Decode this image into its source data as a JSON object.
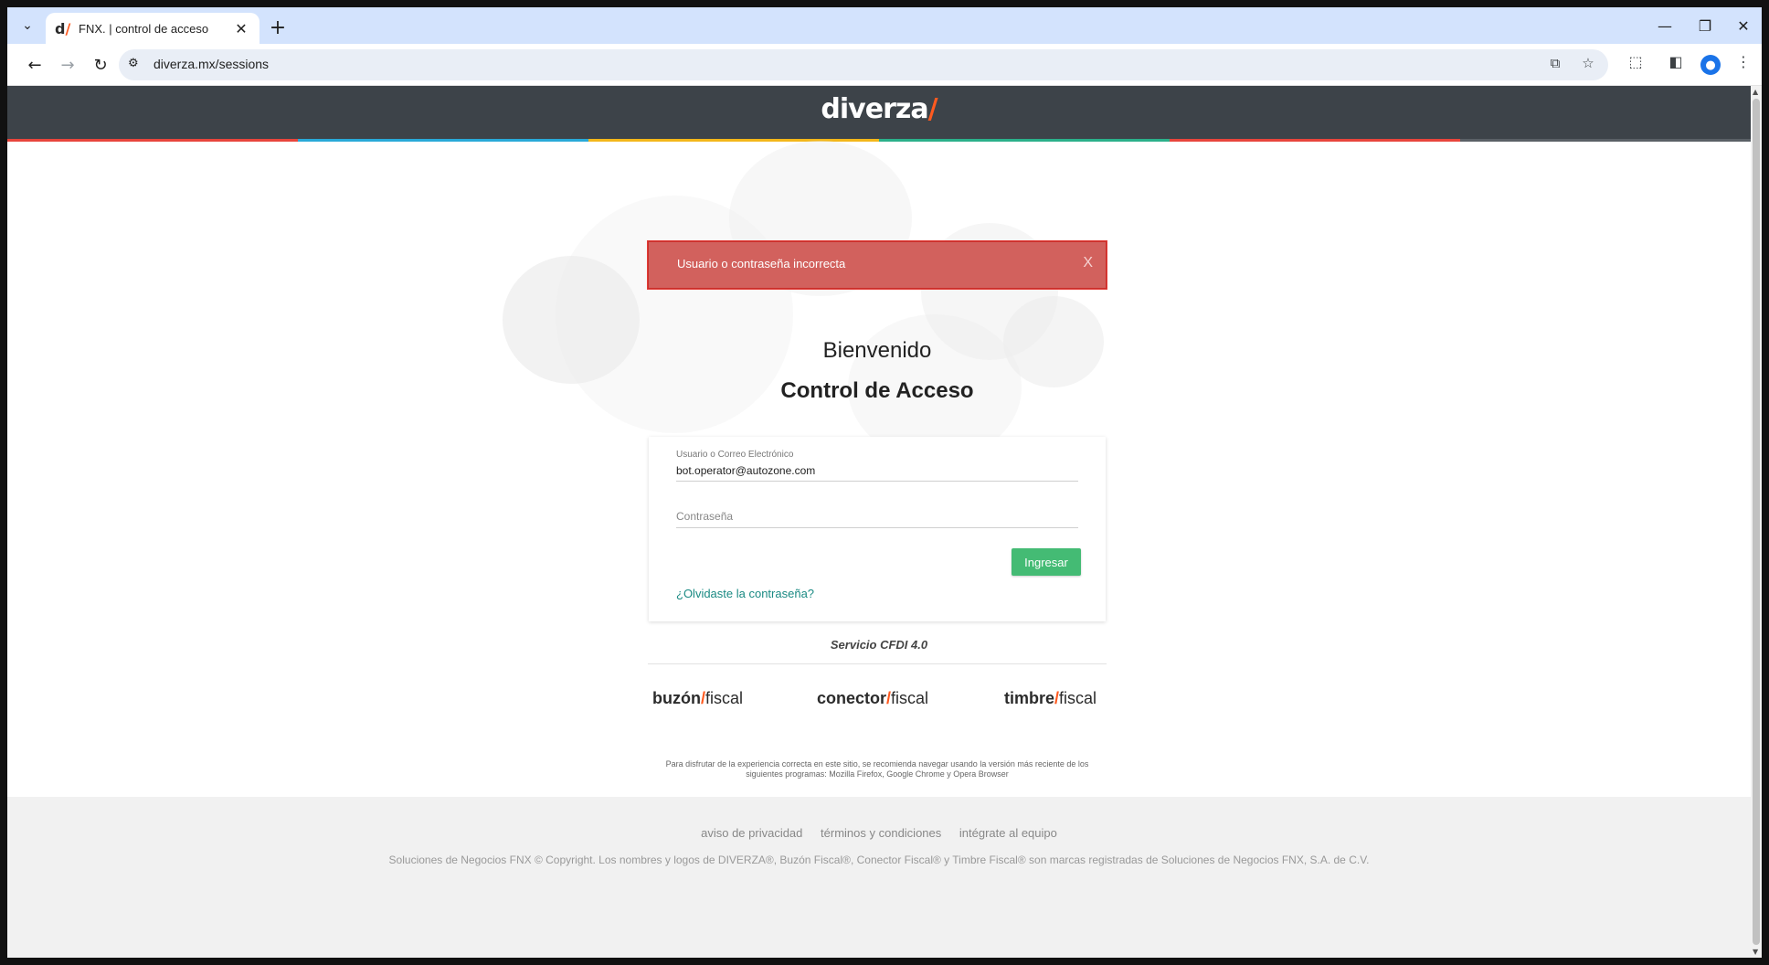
{
  "browser": {
    "tab_title": "FNX. | control de acceso",
    "favicon": "d/",
    "url": "diverza.mx/sessions",
    "icons": [
      "tab-search-icon",
      "close-icon",
      "new-tab-icon",
      "minimize-icon",
      "restore-icon",
      "window-close-icon",
      "back-icon",
      "forward-icon",
      "reload-icon",
      "site-info-icon",
      "translate-icon",
      "bookmark-star-icon",
      "extensions-icon",
      "side-panel-icon",
      "profile-icon",
      "menu-icon"
    ]
  },
  "site": {
    "logo_text": "diverza",
    "logo_slash": "/",
    "colors": {
      "header": "#3d4349",
      "accent": "#ff5a1f",
      "alert": "#d2615d",
      "button": "#44bb74",
      "link": "#1a8a83",
      "stripe": [
        "#e8453c",
        "#29a9d8",
        "#f3b71a",
        "#2bb08a",
        "#e8453c",
        "#3d4349"
      ]
    }
  },
  "alert": {
    "message": "Usuario o contraseña incorrecta",
    "close_label": "X"
  },
  "login": {
    "welcome": "Bienvenido",
    "heading": "Control de Acceso",
    "user_label": "Usuario o Correo Electrónico",
    "user_value": "bot.operator@autozone.com",
    "password_placeholder": "Contraseña",
    "submit_label": "Ingresar",
    "forgot_link": "¿Olvidaste la contraseña?"
  },
  "service_label": "Servicio CFDI 4.0",
  "brands": [
    {
      "name": "buzón",
      "suffix": "fiscal"
    },
    {
      "name": "conector",
      "suffix": "fiscal"
    },
    {
      "name": "timbre",
      "suffix": "fiscal"
    }
  ],
  "browser_notice": {
    "line1": "Para disfrutar de la experiencia correcta en este sitio, se recomienda navegar usando la versión más reciente de los",
    "line2": "siguientes programas: Mozilla Firefox, Google Chrome y Opera Browser"
  },
  "footer": {
    "links": [
      "aviso de privacidad",
      "términos y condiciones",
      "intégrate al equipo"
    ],
    "copyright": "Soluciones de Negocios FNX © Copyright. Los nombres y logos de DIVERZA®, Buzón Fiscal®, Conector Fiscal® y Timbre Fiscal® son marcas registradas de Soluciones de Negocios FNX, S.A. de C.V."
  }
}
